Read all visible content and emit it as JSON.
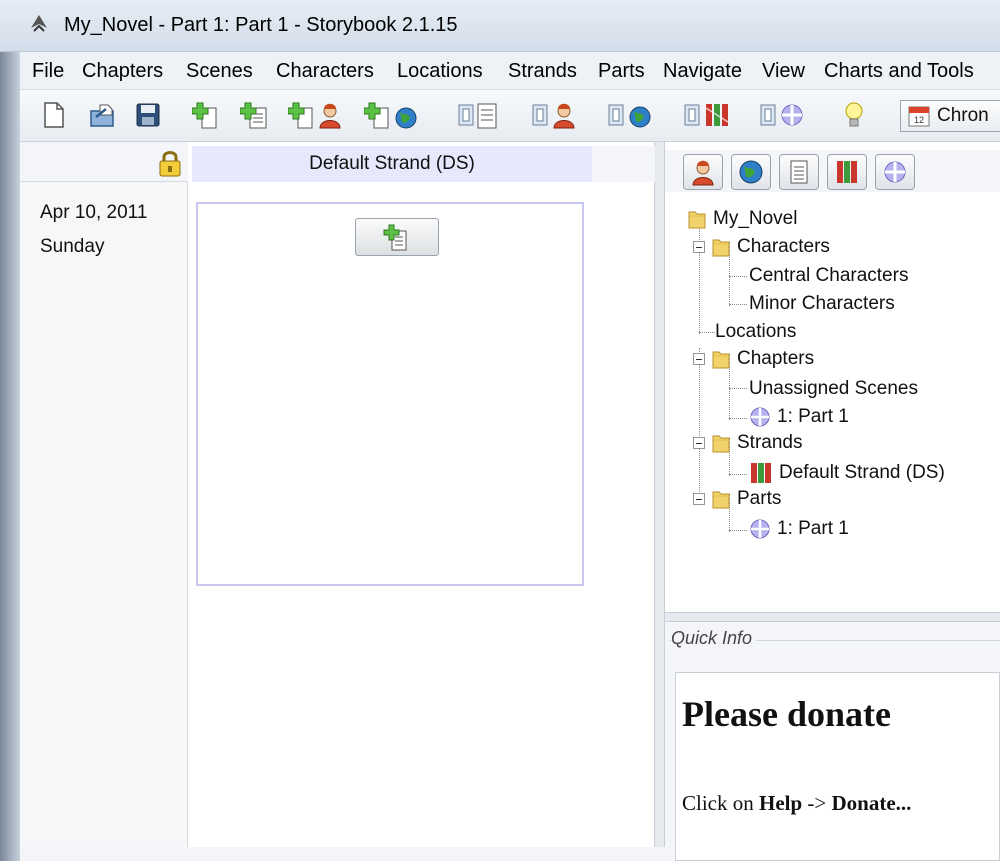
{
  "window": {
    "title": "My_Novel - Part 1: Part 1 - Storybook 2.1.15"
  },
  "menu": [
    {
      "label": "File"
    },
    {
      "label": "Chapters"
    },
    {
      "label": "Scenes"
    },
    {
      "label": "Characters"
    },
    {
      "label": "Locations"
    },
    {
      "label": "Strands"
    },
    {
      "label": "Parts"
    },
    {
      "label": "Navigate"
    },
    {
      "label": "View"
    },
    {
      "label": "Charts and Tools"
    }
  ],
  "toolbar": {
    "buttons": [
      {
        "icon": "new-file-icon"
      },
      {
        "icon": "open-file-icon"
      },
      {
        "icon": "save-icon"
      },
      {
        "icon": "new-chapter-icon"
      },
      {
        "icon": "new-scene-icon"
      },
      {
        "icon": "new-character-icon"
      },
      {
        "icon": "new-location-icon"
      },
      {
        "icon": "manage-chapters-icon"
      },
      {
        "icon": "manage-characters-icon"
      },
      {
        "icon": "manage-locations-icon"
      },
      {
        "icon": "manage-strands-icon"
      },
      {
        "icon": "manage-parts-icon"
      },
      {
        "icon": "idea-lightbulb-icon"
      }
    ],
    "chrono_label": "Chron"
  },
  "chrono_view": {
    "date": "Apr 10, 2011",
    "weekday": "Sunday",
    "strand_header": "Default Strand (DS)"
  },
  "tree": {
    "root": "My_Novel",
    "characters": "Characters",
    "central_characters": "Central Characters",
    "minor_characters": "Minor Characters",
    "locations": "Locations",
    "chapters": "Chapters",
    "unassigned_scenes": "Unassigned Scenes",
    "chapter_1": "1: Part 1",
    "strands": "Strands",
    "default_strand": "Default Strand (DS)",
    "parts": "Parts",
    "part_1": "1: Part 1"
  },
  "quick_info": {
    "title": "Quick Info",
    "heading": "Please donate",
    "text_prefix": "Click on ",
    "text_help": "Help",
    "text_arrow": " -> ",
    "text_donate": "Donate..."
  },
  "colors": {
    "strand_header_bg": "#e6e8fb",
    "scene_border": "#c8c8f0",
    "titlebar": "#dbe4ee"
  }
}
